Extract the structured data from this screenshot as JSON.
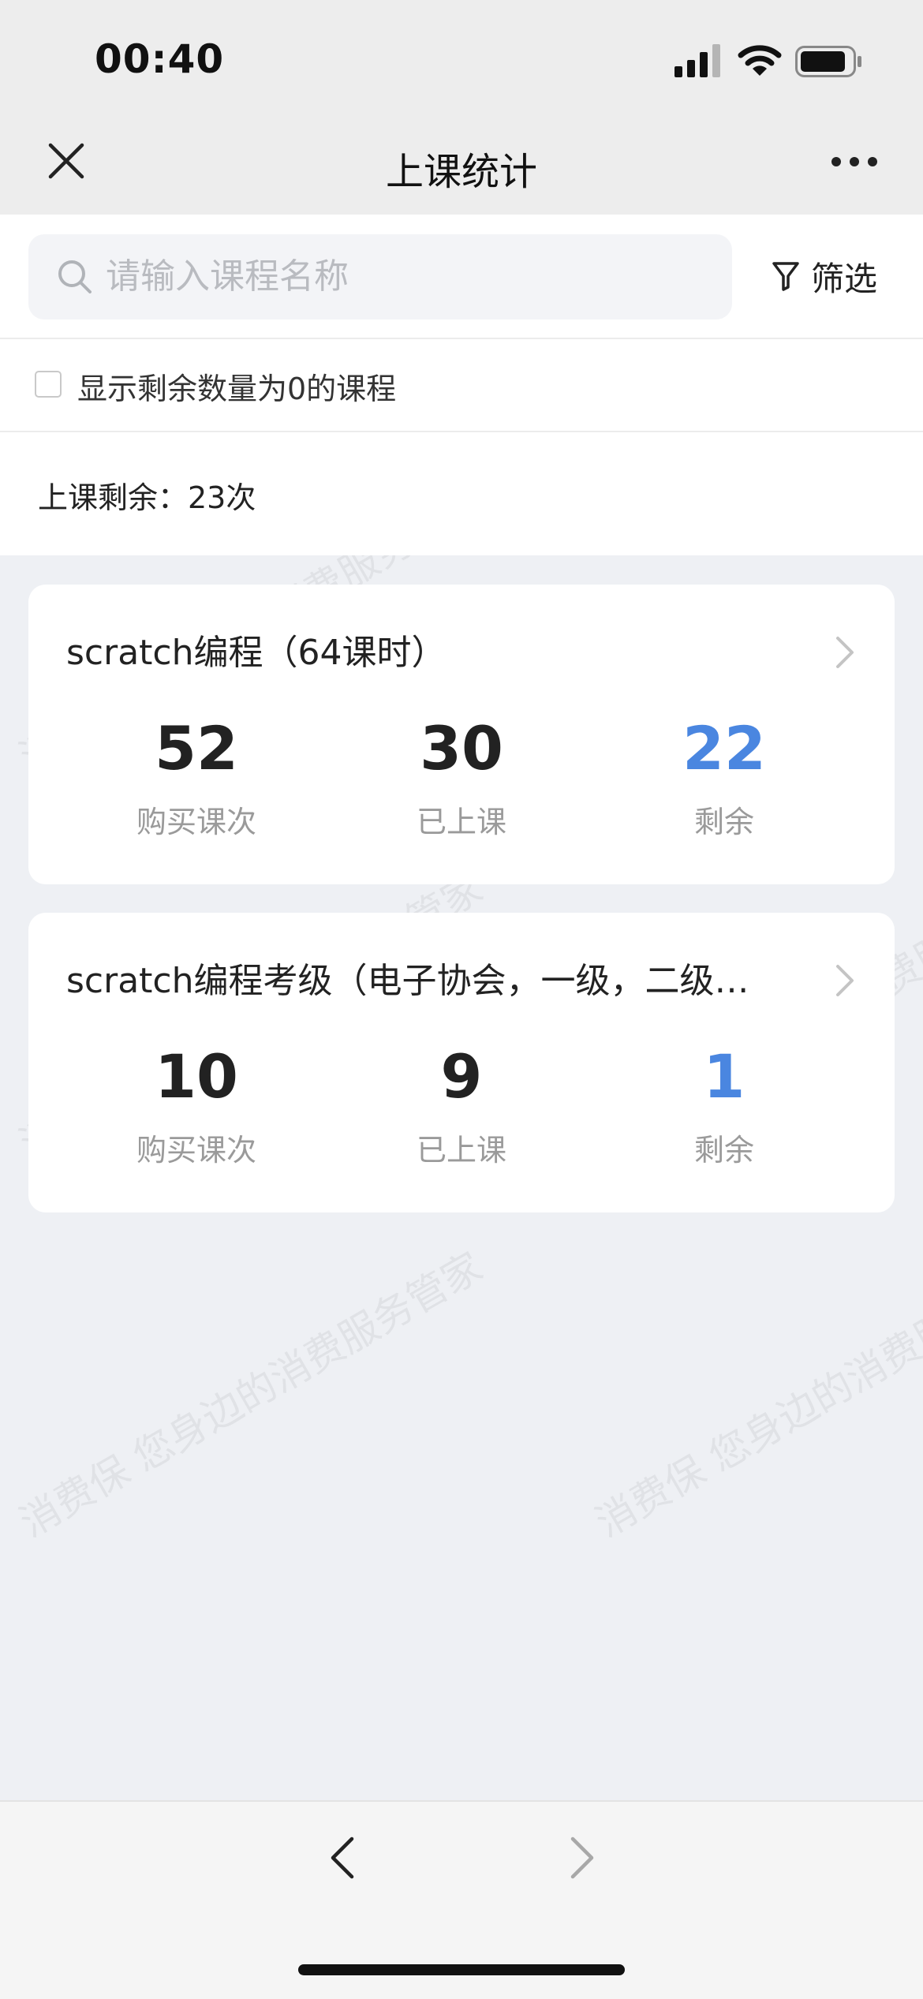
{
  "status_bar": {
    "time": "00:40"
  },
  "nav": {
    "title": "上课统计"
  },
  "search": {
    "placeholder": "请输入课程名称",
    "value": "",
    "filter_label": "筛选"
  },
  "options": {
    "show_zero_label": "显示剩余数量为0的课程",
    "show_zero_checked": false
  },
  "summary": {
    "text": "上课剩余：23次"
  },
  "courses": [
    {
      "title": "scratch编程（64课时）",
      "purchased": "52",
      "purchased_label": "购买课次",
      "attended": "30",
      "attended_label": "已上课",
      "remaining": "22",
      "remaining_label": "剩余"
    },
    {
      "title": "scratch编程考级（电子协会，一级，二级…",
      "purchased": "10",
      "purchased_label": "购买课次",
      "attended": "9",
      "attended_label": "已上课",
      "remaining": "1",
      "remaining_label": "剩余"
    }
  ],
  "watermark": {
    "text": "消费保 您身边的消费服务管家"
  },
  "colors": {
    "accent_blue": "#4a86e0",
    "background": "#eef0f4"
  }
}
